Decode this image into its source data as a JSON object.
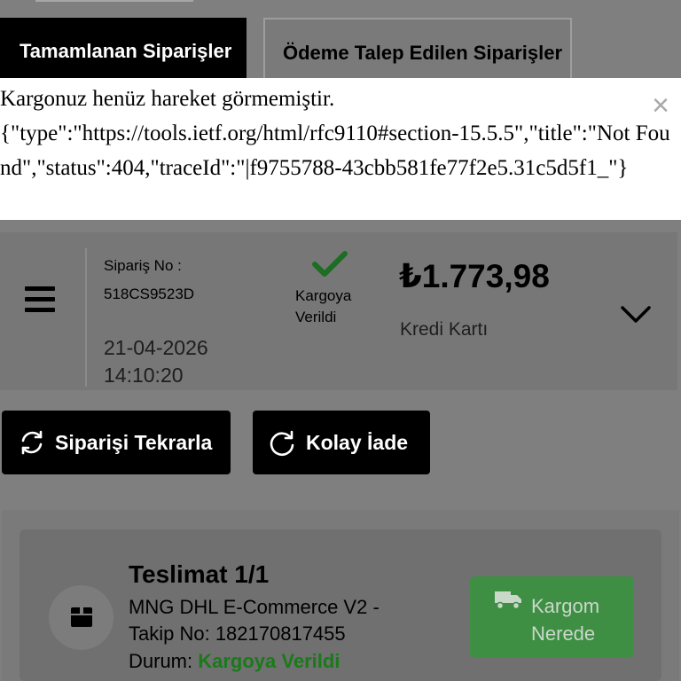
{
  "tabs": [
    {
      "label": "Tamamlanan Siparişler",
      "active": true
    },
    {
      "label": "Ödeme Talep Edilen Siparişler",
      "active": false
    }
  ],
  "toast": {
    "line1": "Kargonuz henüz hareket görmemiştir.",
    "line2": "{\"type\":\"https://tools.ietf.org/html/rfc9110#section-15.5.5\",\"title\":\"Not Found\",\"status\":404,\"traceId\":\"|f9755788-43cbb581fe77f2e5.31c5d5f1_\"}",
    "close_symbol": "×"
  },
  "order": {
    "order_no_label": "Sipariş No :",
    "order_no": "518CS9523D",
    "date": "21-04-2026",
    "time": "14:10:20",
    "status": "Kargoya Verildi",
    "price": "₺1.773,98",
    "payment_method": "Kredi Kartı"
  },
  "actions": {
    "repeat_label": "Siparişi Tekrarla",
    "return_label": "Kolay İade"
  },
  "delivery": {
    "title": "Teslimat 1/1",
    "carrier": "MNG DHL E-Commerce V2 -",
    "tracking": "Takip No: 182170817455",
    "status_label": "Durum:",
    "status_value": "Kargoya Verildi",
    "track_button_line1": "Kargom",
    "track_button_line2": "Nerede"
  },
  "colors": {
    "overlay_gray": "#7f7f7f",
    "button_black": "#000000",
    "status_green": "#1a7a1a",
    "track_button_green": "#3e8e44"
  },
  "icons": [
    "menu-icon",
    "check-icon",
    "chevron-down-icon",
    "refresh-icon",
    "return-icon",
    "box-icon",
    "truck-icon",
    "close-icon"
  ]
}
